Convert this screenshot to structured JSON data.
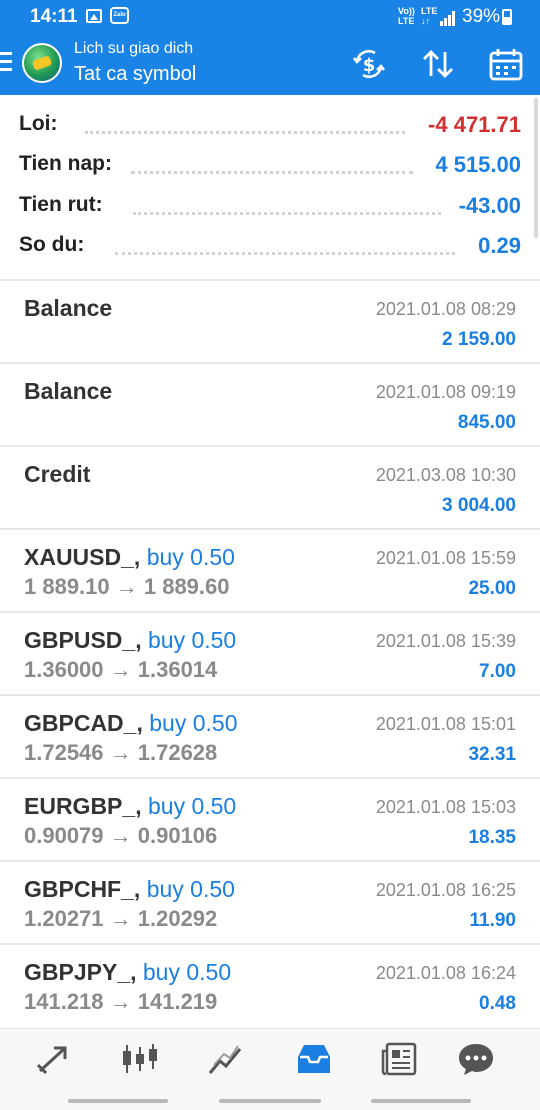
{
  "status_bar": {
    "time": "14:11",
    "notifications": [
      "gallery-icon",
      "zalo-icon"
    ],
    "zalo_label": "Zalo",
    "volte_label": "Vo)) LTE",
    "lte_label": "LTE ↓↑",
    "battery": "39%"
  },
  "toolbar": {
    "title": "Lich su giao dich",
    "subtitle": "Tat ca symbol",
    "actions": [
      "dollar-refresh-icon",
      "sort-icon",
      "calendar-icon"
    ],
    "color": "#1a84e6"
  },
  "summary": {
    "rows": [
      {
        "label": "Loi:",
        "value": "-4 471.71",
        "color": "#d32f2f"
      },
      {
        "label": "Tien nap:",
        "value": "4 515.00",
        "color": "#1a7fe0"
      },
      {
        "label": "Tien rut:",
        "value": "-43.00",
        "color": "#1a7fe0"
      },
      {
        "label": "So du:",
        "value": "0.29",
        "color": "#1a7fe0"
      }
    ]
  },
  "entries": [
    {
      "symbol": "Balance",
      "side": "",
      "prices": "",
      "time": "2021.01.08 08:29",
      "profit": "2 159.00"
    },
    {
      "symbol": "Balance",
      "side": "",
      "prices": "",
      "time": "2021.01.08 09:19",
      "profit": "845.00"
    },
    {
      "symbol": "Credit",
      "side": "",
      "prices": "",
      "time": "2021.03.08 10:30",
      "profit": "3 004.00"
    },
    {
      "symbol": "XAUUSD_,",
      "side": "buy 0.50",
      "prices": "1 889.10 → 1 889.60",
      "time": "2021.01.08 15:59",
      "profit": "25.00"
    },
    {
      "symbol": "GBPUSD_,",
      "side": "buy 0.50",
      "prices": "1.36000 → 1.36014",
      "time": "2021.01.08 15:39",
      "profit": "7.00"
    },
    {
      "symbol": "GBPCAD_,",
      "side": "buy 0.50",
      "prices": "1.72546 → 1.72628",
      "time": "2021.01.08 15:01",
      "profit": "32.31"
    },
    {
      "symbol": "EURGBP_,",
      "side": "buy 0.50",
      "prices": "0.90079 → 0.90106",
      "time": "2021.01.08 15:03",
      "profit": "18.35"
    },
    {
      "symbol": "GBPCHF_,",
      "side": "buy 0.50",
      "prices": "1.20271 → 1.20292",
      "time": "2021.01.08 16:25",
      "profit": "11.90"
    },
    {
      "symbol": "GBPJPY_,",
      "side": "buy 0.50",
      "prices": "141.218 → 141.219",
      "time": "2021.01.08 16:24",
      "profit": "0.48"
    }
  ],
  "bottom_nav": {
    "items": [
      "quotes-icon",
      "chart-icon",
      "trade-icon",
      "history-icon",
      "news-icon",
      "messages-icon"
    ],
    "active": "history-icon",
    "active_color": "#1a7fe0",
    "inactive_color": "#555555"
  }
}
